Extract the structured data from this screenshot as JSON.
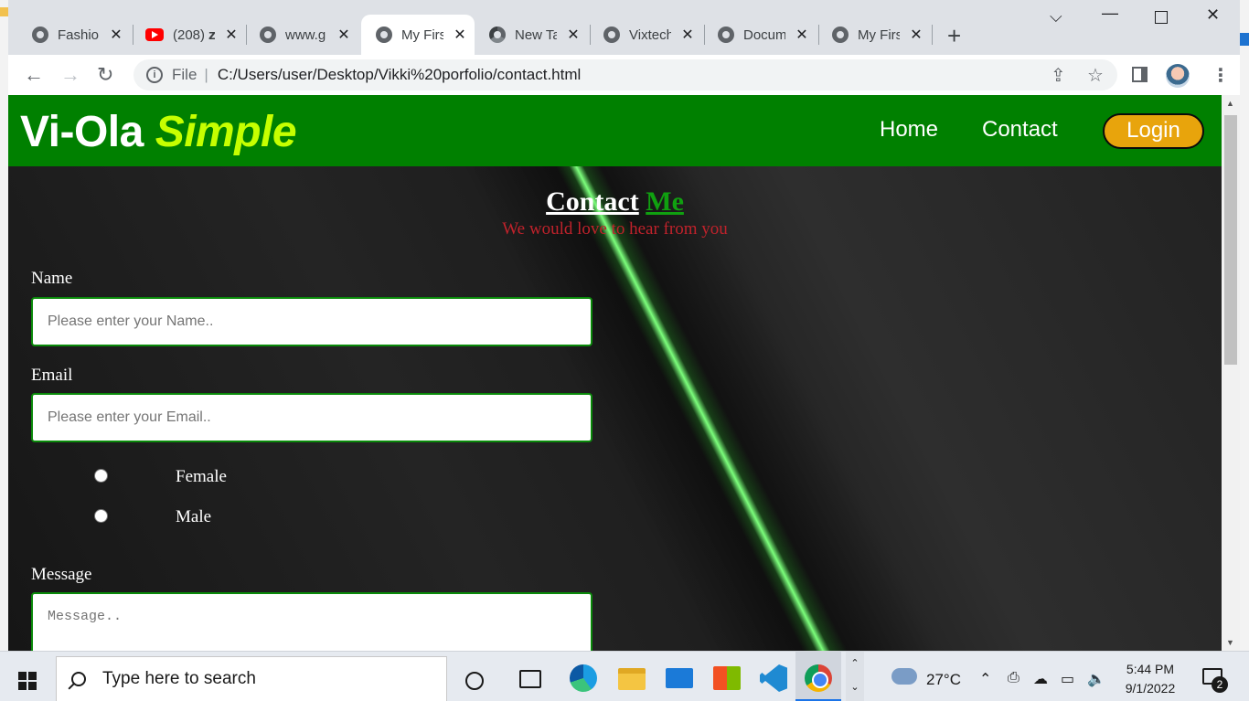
{
  "browser": {
    "tabs": [
      {
        "title": "Fashion",
        "icon": "globe-icon",
        "active": false
      },
      {
        "title": "(208) 𝐳",
        "icon": "youtube-icon",
        "active": false
      },
      {
        "title": "www.g",
        "icon": "globe-icon",
        "active": false
      },
      {
        "title": "My Firs",
        "icon": "globe-icon",
        "active": true
      },
      {
        "title": "New Ta",
        "icon": "chrome-icon",
        "active": false
      },
      {
        "title": "Vixtech",
        "icon": "globe-icon",
        "active": false
      },
      {
        "title": "Docum",
        "icon": "globe-icon",
        "active": false
      },
      {
        "title": "My Firs",
        "icon": "globe-icon",
        "active": false
      }
    ],
    "omnibox": {
      "scheme_label": "File",
      "url": "C:/Users/user/Desktop/Vikki%20porfolio/contact.html"
    }
  },
  "site": {
    "brand": {
      "main": "Vi-Ola",
      "accent": "Simple"
    },
    "nav": {
      "home": "Home",
      "contact": "Contact",
      "login": "Login"
    },
    "colors": {
      "nav_bg": "#008000",
      "brand_accent": "#c6ff00",
      "login_bg": "#e8a40c",
      "subtitle": "#c0222b"
    }
  },
  "contact": {
    "title_main": "Contact",
    "title_accent": "Me",
    "subtitle": "We would love to hear from you",
    "name_label": "Name",
    "name_placeholder": "Please enter your Name..",
    "email_label": "Email",
    "email_placeholder": "Please enter your Email..",
    "gender_options": [
      "Female",
      "Male"
    ],
    "message_label": "Message",
    "message_placeholder": "Message.."
  },
  "taskbar": {
    "search_placeholder": "Type here to search",
    "temperature": "27°C",
    "time": "5:44 PM",
    "date": "9/1/2022",
    "notification_count": "2"
  }
}
